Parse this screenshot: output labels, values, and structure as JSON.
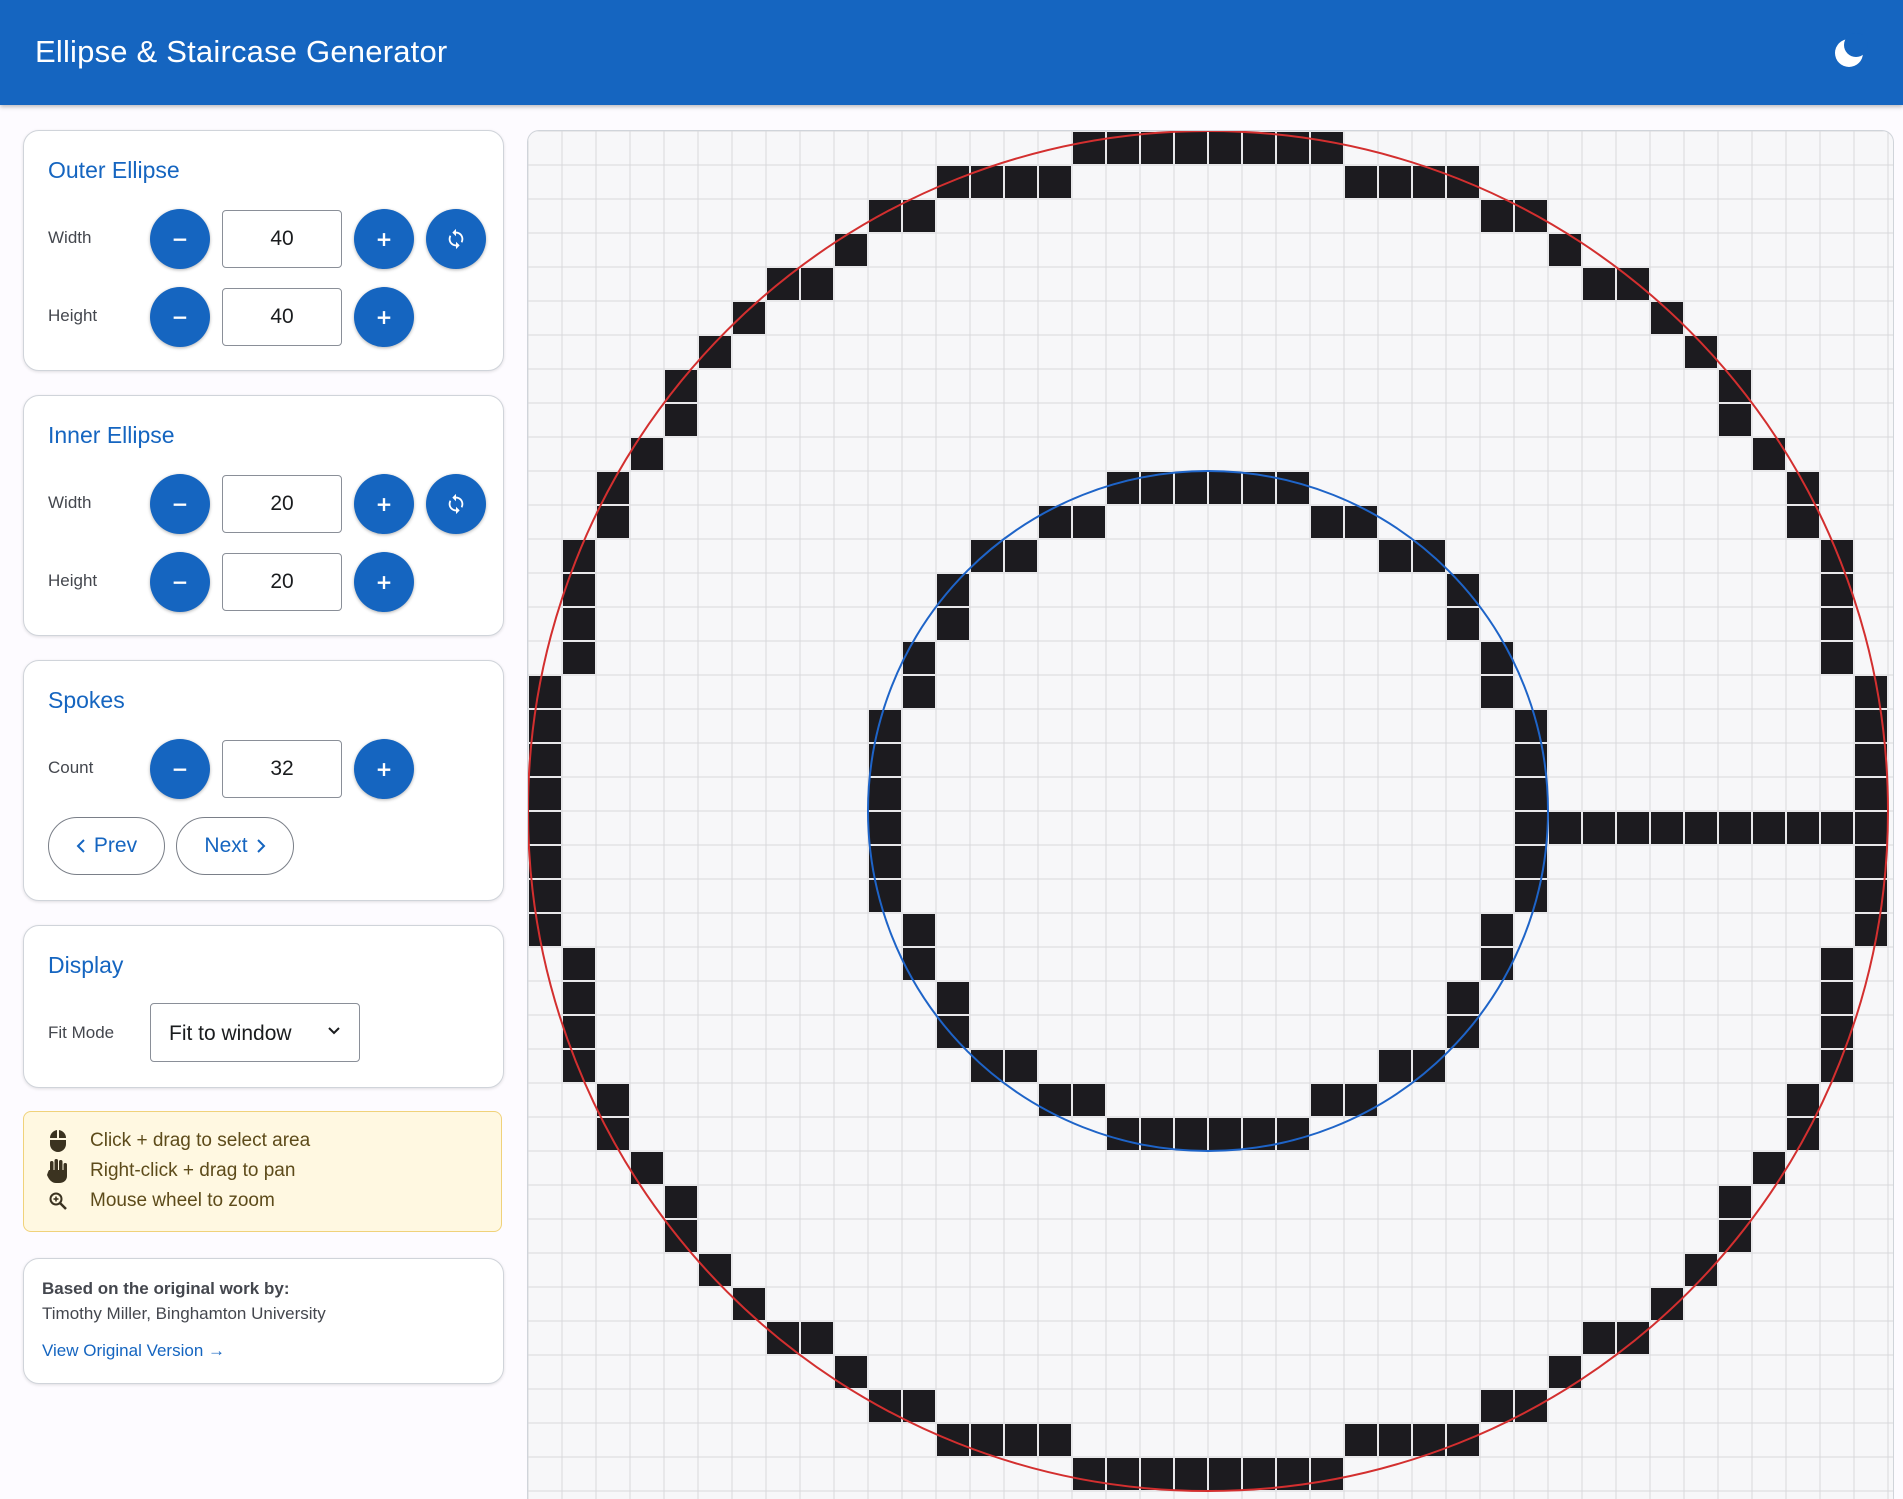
{
  "app": {
    "title": "Ellipse & Staircase Generator"
  },
  "header": {
    "theme_toggle_icon": "moon-icon"
  },
  "outer_ellipse": {
    "title": "Outer Ellipse",
    "width_label": "Width",
    "width_value": "40",
    "height_label": "Height",
    "height_value": "40",
    "decrement_symbol": "−",
    "increment_symbol": "+",
    "sync_icon": "sync-icon",
    "stroke_color": "#d32f2f"
  },
  "inner_ellipse": {
    "title": "Inner Ellipse",
    "width_label": "Width",
    "width_value": "20",
    "height_label": "Height",
    "height_value": "20",
    "decrement_symbol": "−",
    "increment_symbol": "+",
    "sync_icon": "sync-icon",
    "stroke_color": "#1e64c8"
  },
  "spokes": {
    "title": "Spokes",
    "count_label": "Count",
    "count_value": "32",
    "decrement_symbol": "−",
    "increment_symbol": "+",
    "prev_label": "Prev",
    "next_label": "Next"
  },
  "display": {
    "title": "Display",
    "fit_mode_label": "Fit Mode",
    "fit_mode_value": "Fit to window"
  },
  "hints": [
    {
      "icon": "mouse-icon",
      "text": "Click + drag to select area"
    },
    {
      "icon": "hand-icon",
      "text": "Right-click + drag to pan"
    },
    {
      "icon": "zoom-icon",
      "text": "Mouse wheel to zoom"
    }
  ],
  "credits": {
    "title": "Based on the original work by:",
    "name": "Timothy Miller, Binghamton University",
    "link_label": "View Original Version →"
  },
  "colors": {
    "brand": "#1565c0",
    "filled_cell": "#1c1b1f",
    "grid_line": "#d8d8dc"
  }
}
